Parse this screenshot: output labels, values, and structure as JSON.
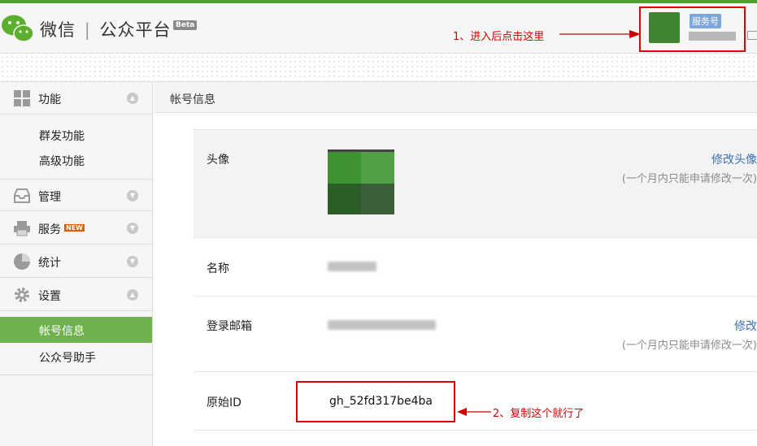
{
  "header": {
    "brand": "微信",
    "separator": "|",
    "product": "公众平台",
    "beta": "Beta",
    "account_type_badge": "服务号",
    "mail_icon": "mail-icon",
    "logo_icon": "wechat-logo-icon"
  },
  "annotations": {
    "step1": "1、进入后点击这里",
    "step2": "2、复制这个就行了",
    "color": "#e00000"
  },
  "sidebar": {
    "sections": [
      {
        "label": "功能",
        "icon": "grid-icon",
        "state": "expanded",
        "items": [
          {
            "label": "群发功能"
          },
          {
            "label": "高级功能"
          }
        ]
      },
      {
        "label": "管理",
        "icon": "inbox-icon",
        "state": "collapsed"
      },
      {
        "label": "服务",
        "icon": "printer-icon",
        "badge": "NEW",
        "state": "collapsed"
      },
      {
        "label": "统计",
        "icon": "pie-chart-icon",
        "state": "collapsed"
      },
      {
        "label": "设置",
        "icon": "gear-icon",
        "state": "expanded",
        "items": [
          {
            "label": "帐号信息",
            "active": true
          },
          {
            "label": "公众号助手"
          }
        ]
      }
    ],
    "active_color": "#6fb14e"
  },
  "main": {
    "title": "帐号信息",
    "rows": {
      "avatar": {
        "label": "头像",
        "action": "修改头像",
        "hint": "(一个月内只能申请修改一次)"
      },
      "name": {
        "label": "名称"
      },
      "email": {
        "label": "登录邮箱",
        "action": "修改",
        "hint": "(一个月内只能申请修改一次)"
      },
      "original_id": {
        "label": "原始ID",
        "value": "gh_52fd317be4ba"
      }
    }
  },
  "colors": {
    "brand_green": "#4ca02b",
    "link_blue": "#3b6fb6"
  }
}
